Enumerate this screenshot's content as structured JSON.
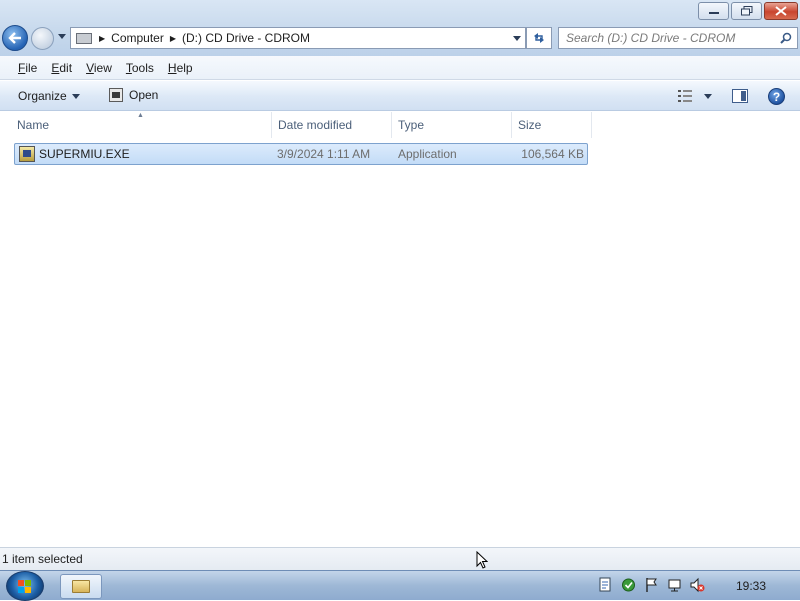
{
  "address": {
    "crumbs": [
      "Computer",
      "(D:) CD Drive - CDROM"
    ]
  },
  "search": {
    "placeholder": "Search (D:) CD Drive - CDROM"
  },
  "menu": {
    "items": [
      {
        "first": "F",
        "rest": "ile"
      },
      {
        "first": "E",
        "rest": "dit"
      },
      {
        "first": "V",
        "rest": "iew"
      },
      {
        "first": "T",
        "rest": "ools"
      },
      {
        "first": "H",
        "rest": "elp"
      }
    ]
  },
  "toolbar": {
    "organize_label": "Organize",
    "open_label": "Open",
    "help_glyph": "?"
  },
  "columns": [
    "Name",
    "Date modified",
    "Type",
    "Size"
  ],
  "files": [
    {
      "name": "SUPERMIU.EXE",
      "date_modified": "3/9/2024 1:11 AM",
      "type": "Application",
      "size": "106,564 KB",
      "selected": true
    }
  ],
  "status": {
    "text": "1 item selected"
  },
  "taskbar": {
    "clock": "19:33"
  },
  "icons": {
    "back": "back-arrow-icon",
    "forward": "forward-arrow-icon",
    "refresh": "refresh-icon",
    "search": "search-icon",
    "views": "views-icon",
    "preview_pane": "preview-pane-icon",
    "help": "help-icon",
    "file": "application-exe-icon"
  },
  "colors": {
    "selection_bg": "#c3dcf7",
    "selection_border": "#7da2ce",
    "accent": "#1c4f9e"
  }
}
